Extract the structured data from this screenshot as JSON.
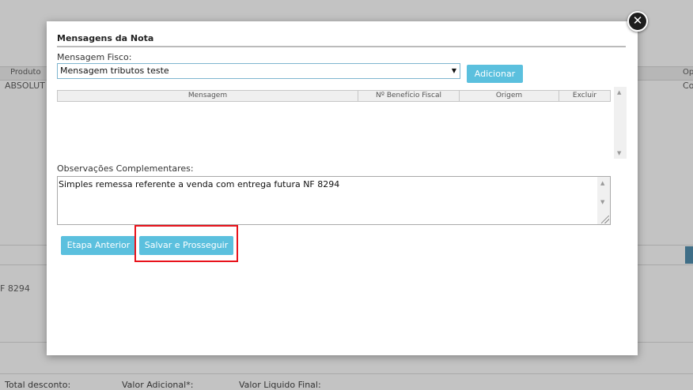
{
  "background": {
    "col_produto": "Produto",
    "col_op": "Op",
    "cell_absolut": "ABSOLUT",
    "cell_co": "Co",
    "obs_fragment": "F 8294",
    "footer": {
      "total_desconto": "Total desconto:",
      "valor_adicional": "Valor Adicional*:",
      "valor_liquido": "Valor Liquido Final:"
    }
  },
  "modal": {
    "title": "Mensagens da Nota",
    "mensagem_fisco_label": "Mensagem Fisco:",
    "mensagem_fisco_value": "Mensagem tributos teste",
    "add_button": "Adicionar",
    "grid_columns": [
      "Mensagem",
      "Nº Benefício Fiscal",
      "Origem",
      "Excluir"
    ],
    "observacoes_label": "Observações Complementares:",
    "observacoes_value": "Simples remessa referente a venda com entrega futura NF 8294",
    "prev_button": "Etapa Anterior",
    "save_button": "Salvar e Prosseguir",
    "close_glyph": "✕"
  },
  "colors": {
    "button": "#5bc0de",
    "highlight": "#e8121b",
    "select_border": "#7fb6cf"
  }
}
